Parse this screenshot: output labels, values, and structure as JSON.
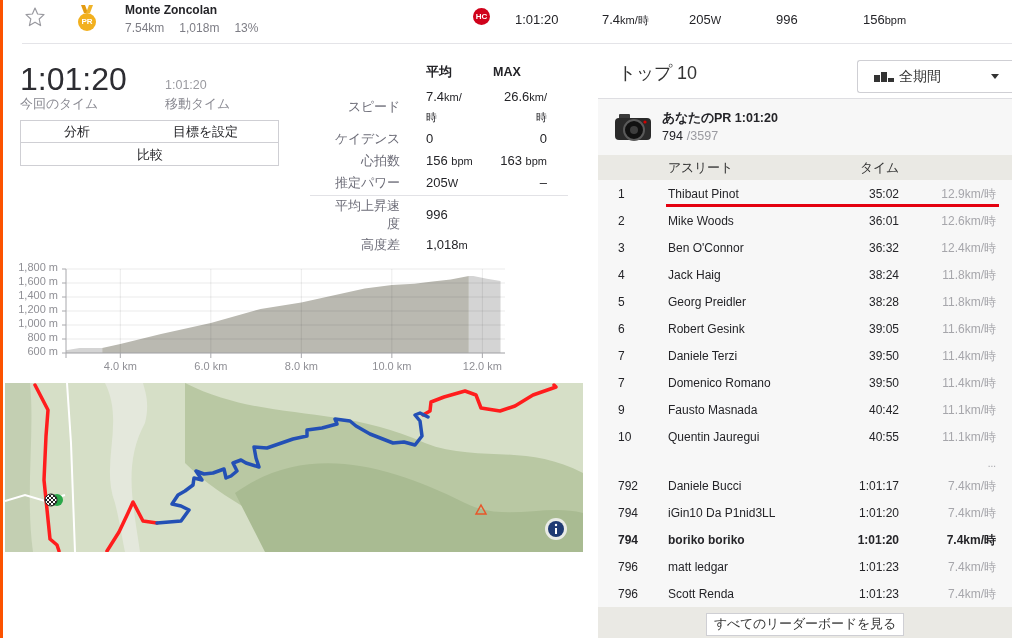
{
  "segment_header": {
    "starred": false,
    "achievement": "PR",
    "name": "Monte Zoncolan",
    "distance": "7.54km",
    "elevation": "1,018m",
    "grade": "13%",
    "category": "HC",
    "stats": [
      "1:01:20",
      "7.4km/時",
      "205W",
      "996",
      "156bpm"
    ]
  },
  "effort": {
    "elapsed_time": "1:01:20",
    "elapsed_label": "今回のタイム",
    "moving_time": "1:01:20",
    "moving_label": "移動タイム",
    "buttons": [
      "分析",
      "目標を設定",
      "比較"
    ]
  },
  "stats_table": {
    "columns": [
      "平均",
      "MAX"
    ],
    "rows": [
      {
        "label": "スピード",
        "average": "7.4km/時",
        "max": "26.6km/時"
      },
      {
        "label": "ケイデンス",
        "average": "0",
        "max": "0"
      },
      {
        "label": "心拍数",
        "average": "156 bpm",
        "max": "163 bpm"
      },
      {
        "label": "推定パワー",
        "average": "205W",
        "max": "–"
      }
    ],
    "summary_rows": [
      {
        "label": "平均上昇速度",
        "value": "996"
      },
      {
        "label": "高度差",
        "value": "1,018m"
      }
    ]
  },
  "elevation_profile": {
    "chart_data": {
      "type": "area",
      "grid": true,
      "x": [
        2.8,
        3.1,
        3.6,
        4.0,
        4.9,
        6.0,
        7.1,
        8.0,
        8.7,
        9.4,
        10.0,
        10.5,
        10.9,
        11.3,
        11.7,
        11.8,
        12.1,
        12.4
      ],
      "series": [
        {
          "color": "#d4d4d4",
          "values": [
            640,
            670,
            670,
            null,
            null,
            null,
            null,
            null,
            null,
            null,
            null,
            null,
            null,
            null,
            1700,
            1700,
            1660,
            1630
          ]
        },
        {
          "color": "#bab9b1",
          "values": [
            null,
            null,
            670,
            730,
            870,
            1030,
            1230,
            1320,
            1420,
            1520,
            1570,
            1590,
            1620,
            1650,
            1700,
            null,
            null,
            null
          ]
        }
      ],
      "xlim": [
        2.8,
        12.5
      ],
      "ylim": [
        600,
        1800
      ],
      "xticks": [
        {
          "value": 4,
          "label": "4.0 km"
        },
        {
          "value": 6,
          "label": "6.0 km"
        },
        {
          "value": 8,
          "label": "8.0 km"
        },
        {
          "value": 10,
          "label": "10.0 km"
        },
        {
          "value": 12,
          "label": "12.0 km"
        }
      ],
      "yticks": [
        {
          "value": 600,
          "label": "600 m"
        },
        {
          "value": 800,
          "label": "800 m"
        },
        {
          "value": 1000,
          "label": "1,000 m"
        },
        {
          "value": 1200,
          "label": "1,200 m"
        },
        {
          "value": 1400,
          "label": "1,400 m"
        },
        {
          "value": 1600,
          "label": "1,600 m"
        },
        {
          "value": 1800,
          "label": "1,800 m"
        }
      ]
    }
  },
  "leaderboard": {
    "title": "トップ 10",
    "filter": "全期間",
    "personal_record": {
      "label": "あなたのPR 1:01:20",
      "rank": "794",
      "total": "/3597"
    },
    "columns": [
      "アスリート",
      "タイム"
    ],
    "top_rows": [
      {
        "rank": "1",
        "name": "Thibaut Pinot",
        "time": "35:02",
        "speed": "12.9km/時",
        "selected": true,
        "current_user": false
      },
      {
        "rank": "2",
        "name": "Mike Woods",
        "time": "36:01",
        "speed": "12.6km/時",
        "selected": false,
        "current_user": false
      },
      {
        "rank": "3",
        "name": "Ben O'Connor",
        "time": "36:32",
        "speed": "12.4km/時",
        "selected": false,
        "current_user": false
      },
      {
        "rank": "4",
        "name": "Jack Haig",
        "time": "38:24",
        "speed": "11.8km/時",
        "selected": false,
        "current_user": false
      },
      {
        "rank": "5",
        "name": "Georg Preidler",
        "time": "38:28",
        "speed": "11.8km/時",
        "selected": false,
        "current_user": false
      },
      {
        "rank": "6",
        "name": "Robert Gesink",
        "time": "39:05",
        "speed": "11.6km/時",
        "selected": false,
        "current_user": false
      },
      {
        "rank": "7",
        "name": "Daniele Terzi",
        "time": "39:50",
        "speed": "11.4km/時",
        "selected": false,
        "current_user": false
      },
      {
        "rank": "7",
        "name": "Domenico Romano",
        "time": "39:50",
        "speed": "11.4km/時",
        "selected": false,
        "current_user": false
      },
      {
        "rank": "9",
        "name": "Fausto Masnada",
        "time": "40:42",
        "speed": "11.1km/時",
        "selected": false,
        "current_user": false
      },
      {
        "rank": "10",
        "name": "Quentin Jauregui",
        "time": "40:55",
        "speed": "11.1km/時",
        "selected": false,
        "current_user": false
      }
    ],
    "ellipsis": "...",
    "nearby_rows": [
      {
        "rank": "792",
        "name": "Daniele Bucci",
        "time": "1:01:17",
        "speed": "7.4km/時",
        "selected": false,
        "current_user": false
      },
      {
        "rank": "794",
        "name": "iGin10 Da P1nid3LL",
        "time": "1:01:20",
        "speed": "7.4km/時",
        "selected": false,
        "current_user": false
      },
      {
        "rank": "794",
        "name": "boriko boriko",
        "time": "1:01:20",
        "speed": "7.4km/時",
        "selected": false,
        "current_user": true
      },
      {
        "rank": "796",
        "name": "matt ledgar",
        "time": "1:01:23",
        "speed": "7.4km/時",
        "selected": false,
        "current_user": false
      },
      {
        "rank": "796",
        "name": "Scott Renda",
        "time": "1:01:23",
        "speed": "7.4km/時",
        "selected": false,
        "current_user": false
      }
    ],
    "footer_button": "すべてのリーダーボードを見る"
  }
}
